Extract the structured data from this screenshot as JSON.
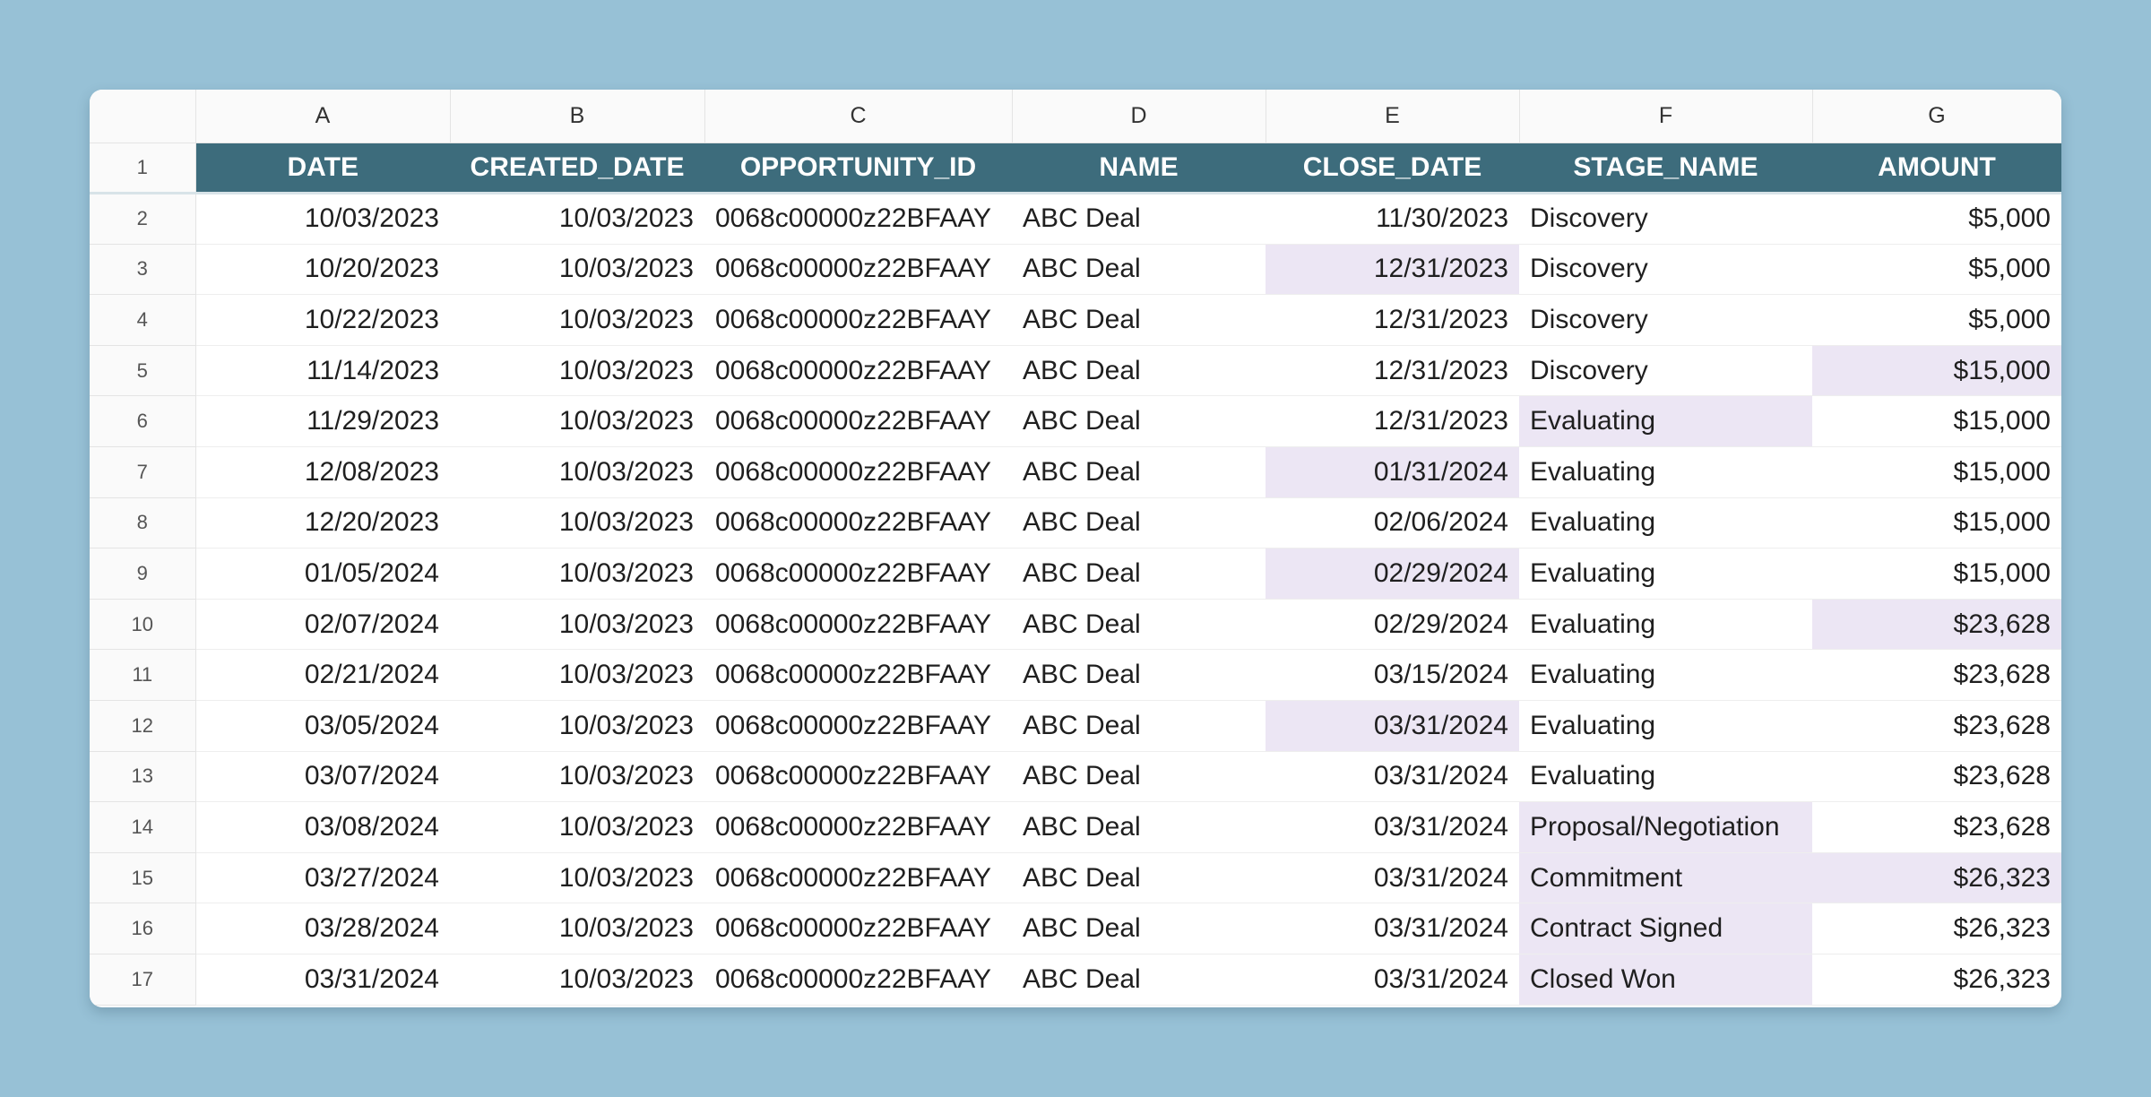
{
  "column_letters": [
    "A",
    "B",
    "C",
    "D",
    "E",
    "F",
    "G"
  ],
  "headers": [
    "DATE",
    "CREATED_DATE",
    "OPPORTUNITY_ID",
    "NAME",
    "CLOSE_DATE",
    "STAGE_NAME",
    "AMOUNT"
  ],
  "header_row_number": "1",
  "highlight_color": "#ece6f4",
  "header_color": "#3d6c7c",
  "rows": [
    {
      "num": "2",
      "date": "10/03/2023",
      "created": "10/03/2023",
      "opp_id": "0068c00000z22BFAAY",
      "name": "ABC Deal",
      "close": "11/30/2023",
      "stage": "Discovery",
      "amount": "$5,000",
      "hl": []
    },
    {
      "num": "3",
      "date": "10/20/2023",
      "created": "10/03/2023",
      "opp_id": "0068c00000z22BFAAY",
      "name": "ABC Deal",
      "close": "12/31/2023",
      "stage": "Discovery",
      "amount": "$5,000",
      "hl": [
        "close"
      ]
    },
    {
      "num": "4",
      "date": "10/22/2023",
      "created": "10/03/2023",
      "opp_id": "0068c00000z22BFAAY",
      "name": "ABC Deal",
      "close": "12/31/2023",
      "stage": "Discovery",
      "amount": "$5,000",
      "hl": []
    },
    {
      "num": "5",
      "date": "11/14/2023",
      "created": "10/03/2023",
      "opp_id": "0068c00000z22BFAAY",
      "name": "ABC Deal",
      "close": "12/31/2023",
      "stage": "Discovery",
      "amount": "$15,000",
      "hl": [
        "amount"
      ]
    },
    {
      "num": "6",
      "date": "11/29/2023",
      "created": "10/03/2023",
      "opp_id": "0068c00000z22BFAAY",
      "name": "ABC Deal",
      "close": "12/31/2023",
      "stage": "Evaluating",
      "amount": "$15,000",
      "hl": [
        "stage"
      ]
    },
    {
      "num": "7",
      "date": "12/08/2023",
      "created": "10/03/2023",
      "opp_id": "0068c00000z22BFAAY",
      "name": "ABC Deal",
      "close": "01/31/2024",
      "stage": "Evaluating",
      "amount": "$15,000",
      "hl": [
        "close"
      ]
    },
    {
      "num": "8",
      "date": "12/20/2023",
      "created": "10/03/2023",
      "opp_id": "0068c00000z22BFAAY",
      "name": "ABC Deal",
      "close": "02/06/2024",
      "stage": "Evaluating",
      "amount": "$15,000",
      "hl": []
    },
    {
      "num": "9",
      "date": "01/05/2024",
      "created": "10/03/2023",
      "opp_id": "0068c00000z22BFAAY",
      "name": "ABC Deal",
      "close": "02/29/2024",
      "stage": "Evaluating",
      "amount": "$15,000",
      "hl": [
        "close"
      ]
    },
    {
      "num": "10",
      "date": "02/07/2024",
      "created": "10/03/2023",
      "opp_id": "0068c00000z22BFAAY",
      "name": "ABC Deal",
      "close": "02/29/2024",
      "stage": "Evaluating",
      "amount": "$23,628",
      "hl": [
        "amount"
      ]
    },
    {
      "num": "11",
      "date": "02/21/2024",
      "created": "10/03/2023",
      "opp_id": "0068c00000z22BFAAY",
      "name": "ABC Deal",
      "close": "03/15/2024",
      "stage": "Evaluating",
      "amount": "$23,628",
      "hl": []
    },
    {
      "num": "12",
      "date": "03/05/2024",
      "created": "10/03/2023",
      "opp_id": "0068c00000z22BFAAY",
      "name": "ABC Deal",
      "close": "03/31/2024",
      "stage": "Evaluating",
      "amount": "$23,628",
      "hl": [
        "close"
      ]
    },
    {
      "num": "13",
      "date": "03/07/2024",
      "created": "10/03/2023",
      "opp_id": "0068c00000z22BFAAY",
      "name": "ABC Deal",
      "close": "03/31/2024",
      "stage": "Evaluating",
      "amount": "$23,628",
      "hl": []
    },
    {
      "num": "14",
      "date": "03/08/2024",
      "created": "10/03/2023",
      "opp_id": "0068c00000z22BFAAY",
      "name": "ABC Deal",
      "close": "03/31/2024",
      "stage": "Proposal/Negotiation",
      "amount": "$23,628",
      "hl": [
        "stage"
      ]
    },
    {
      "num": "15",
      "date": "03/27/2024",
      "created": "10/03/2023",
      "opp_id": "0068c00000z22BFAAY",
      "name": "ABC Deal",
      "close": "03/31/2024",
      "stage": "Commitment",
      "amount": "$26,323",
      "hl": [
        "stage",
        "amount"
      ]
    },
    {
      "num": "16",
      "date": "03/28/2024",
      "created": "10/03/2023",
      "opp_id": "0068c00000z22BFAAY",
      "name": "ABC Deal",
      "close": "03/31/2024",
      "stage": "Contract Signed",
      "amount": "$26,323",
      "hl": [
        "stage"
      ]
    },
    {
      "num": "17",
      "date": "03/31/2024",
      "created": "10/03/2023",
      "opp_id": "0068c00000z22BFAAY",
      "name": "ABC Deal",
      "close": "03/31/2024",
      "stage": "Closed Won",
      "amount": "$26,323",
      "hl": [
        "stage"
      ]
    }
  ]
}
